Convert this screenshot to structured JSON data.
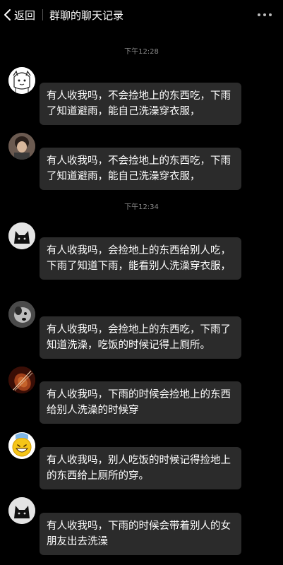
{
  "header": {
    "back_label": "返回",
    "title": "群聊的聊天记录"
  },
  "timestamps": [
    "下午12:28",
    "下午12:34"
  ],
  "messages": [
    {
      "text": "有人收我吗，不会捡地上的东西吃，下雨了知道避雨，能自己洗澡穿衣服，",
      "avatar": "cartoon-girl"
    },
    {
      "text": "有人收我吗，不会捡地上的东西吃，下雨了知道避雨，能自己洗澡穿衣服，",
      "avatar": "portrait-photo"
    },
    {
      "text": "有人收我吗，会捡地上的东西给别人吃，下雨了知道下雨，能看别人洗澡穿衣服，",
      "avatar": "black-cat"
    },
    {
      "text": "有人收我吗，会捡地上的东西吃，下雨了知道洗澡，吃饭的时候记得上厕所。",
      "avatar": "dog-photo"
    },
    {
      "text": "有人收我吗，下雨的时候会捡地上的东西给别人洗澡的时候穿",
      "avatar": "violin-photo"
    },
    {
      "text": "有人收我吗，别人吃饭的时候记得捡地上的东西给上厕所的穿。",
      "avatar": "grin-emoji"
    },
    {
      "text": "有人收我吗，下雨的时候会带着别人的女朋友出去洗澡",
      "avatar": "black-cat"
    }
  ],
  "colors": {
    "background": "#000000",
    "bubble": "#2b2b2b",
    "timestamp": "#8a8a8a"
  }
}
